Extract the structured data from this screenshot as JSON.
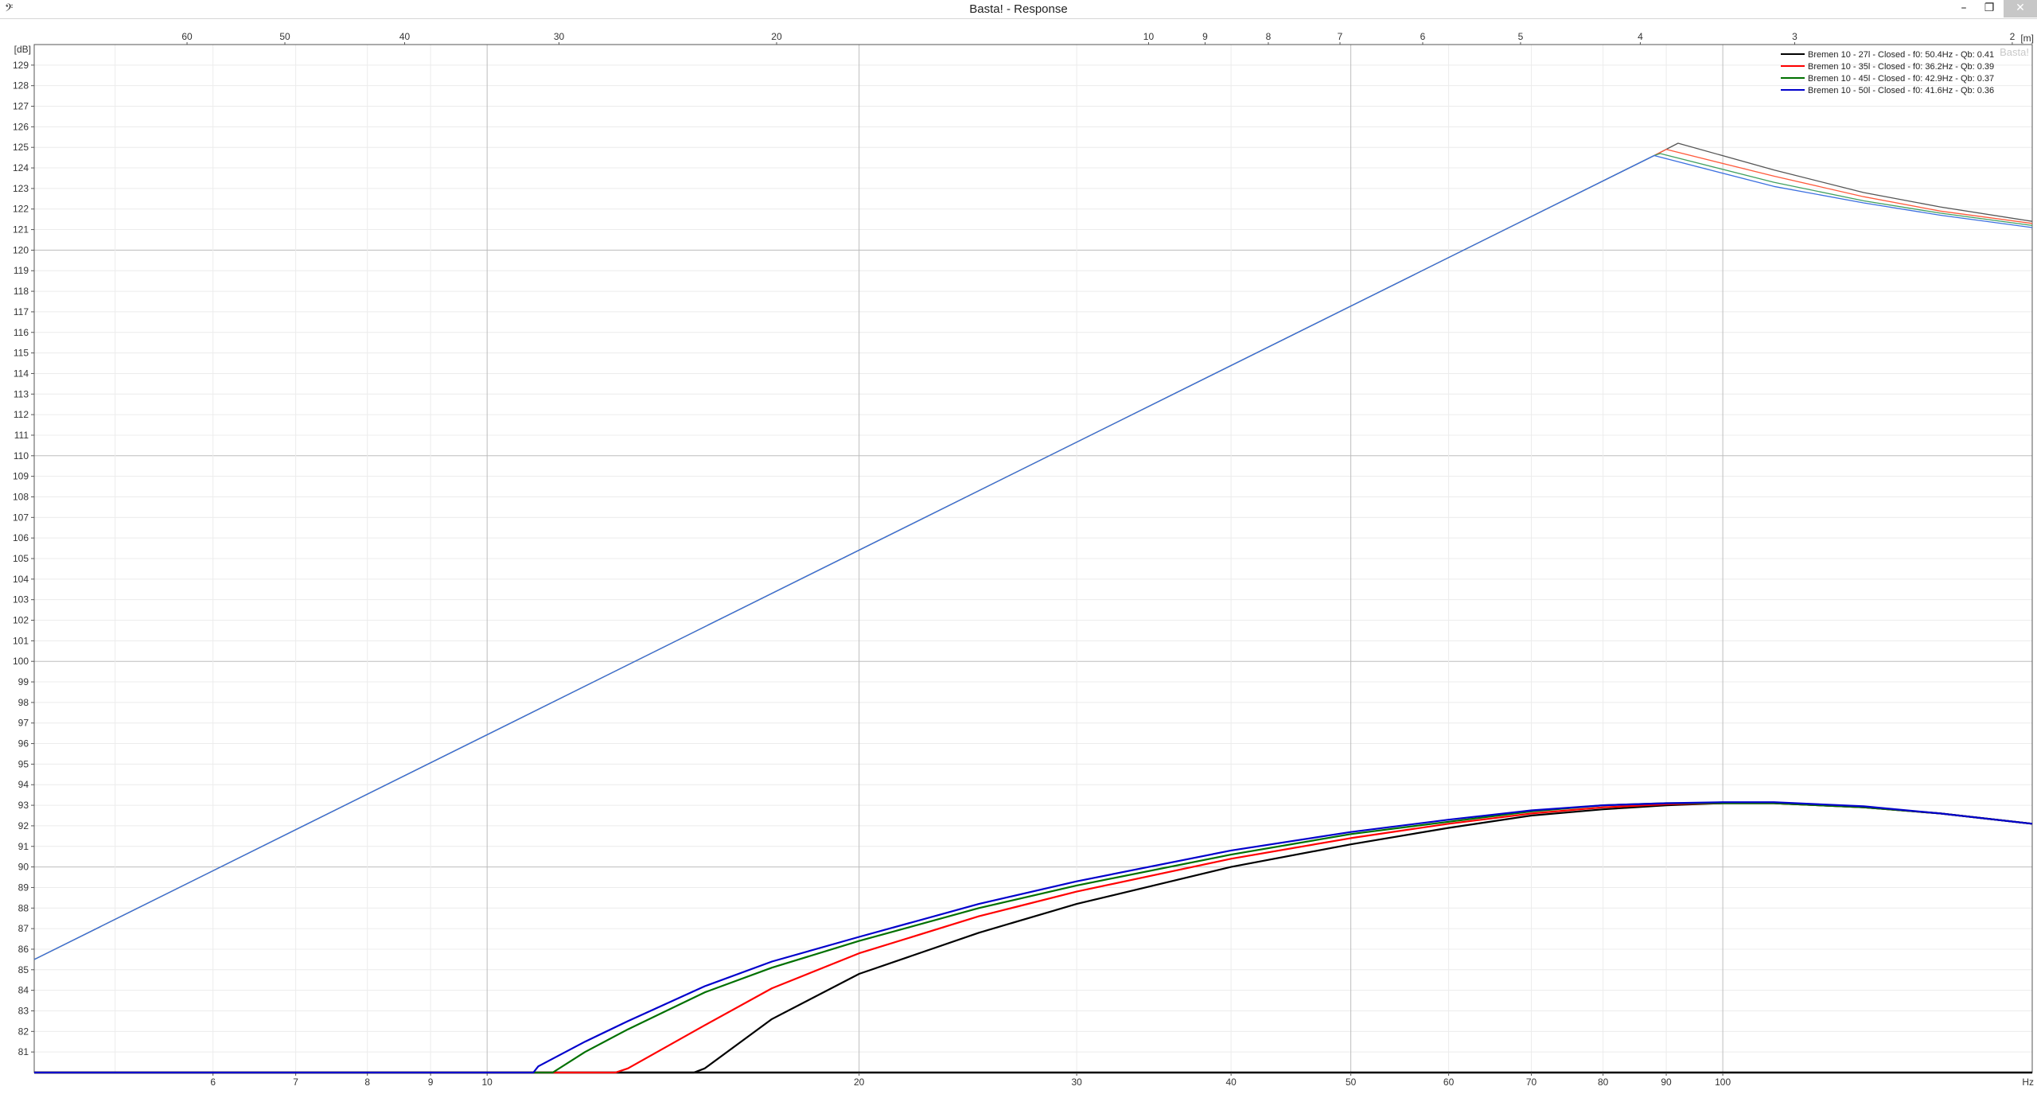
{
  "window": {
    "title": "Basta! - Response",
    "icon": "bass-clef-icon",
    "minimize": "–",
    "restore": "❐",
    "close": "✕"
  },
  "chart_data": {
    "type": "line",
    "title": "",
    "watermark": "Basta!",
    "xlabel": "",
    "x_unit": "Hz",
    "y_unit": "[dB]",
    "top_unit": "[m]",
    "x_scale": "log",
    "xlim": [
      4.3,
      178
    ],
    "ylim": [
      80,
      130
    ],
    "grid": true,
    "legend_position": "top-right",
    "x_ticks": [
      6,
      7,
      8,
      9,
      10,
      20,
      30,
      40,
      50,
      60,
      70,
      80,
      90,
      100
    ],
    "x_major_grid": [
      10,
      20,
      50,
      100
    ],
    "top_ticks": [
      60,
      50,
      40,
      30,
      20,
      10,
      9,
      8,
      7,
      6,
      5,
      4,
      3,
      2
    ],
    "y_ticks": [
      81,
      82,
      83,
      84,
      85,
      86,
      87,
      88,
      89,
      90,
      91,
      92,
      93,
      94,
      95,
      96,
      97,
      98,
      99,
      100,
      101,
      102,
      103,
      104,
      105,
      106,
      107,
      108,
      109,
      110,
      111,
      112,
      113,
      114,
      115,
      116,
      117,
      118,
      119,
      120,
      121,
      122,
      123,
      124,
      125,
      126,
      127,
      128,
      129
    ],
    "y_major_grid": [
      90,
      100,
      110,
      120
    ],
    "room_gain_series": [
      {
        "name": "",
        "color": "#555555",
        "x": [
          4.3,
          88,
          92,
          110,
          130,
          150,
          178
        ],
        "y": [
          85.5,
          124.6,
          125.2,
          123.9,
          122.8,
          122.1,
          121.4
        ]
      },
      {
        "name": "",
        "color": "#ff5a3c",
        "x": [
          4.3,
          88,
          90,
          110,
          130,
          150,
          178
        ],
        "y": [
          85.5,
          124.6,
          124.9,
          123.6,
          122.6,
          121.9,
          121.3
        ]
      },
      {
        "name": "",
        "color": "#40a060",
        "x": [
          4.3,
          88,
          89,
          110,
          130,
          150,
          178
        ],
        "y": [
          85.5,
          124.6,
          124.7,
          123.3,
          122.4,
          121.8,
          121.2
        ]
      },
      {
        "name": "",
        "color": "#3b6fe0",
        "x": [
          4.3,
          88,
          110,
          130,
          150,
          178
        ],
        "y": [
          85.5,
          124.6,
          123.1,
          122.3,
          121.7,
          121.1
        ]
      }
    ],
    "series": [
      {
        "name": "Bremen 10 - 27l - Closed - f0: 50.4Hz - Qb: 0.41",
        "color": "#000000",
        "x": [
          4.3,
          14.7,
          15,
          17,
          20,
          25,
          30,
          40,
          50,
          60,
          70,
          80,
          90,
          100,
          110,
          130,
          150,
          178
        ],
        "y": [
          80,
          80,
          80.2,
          82.6,
          84.8,
          86.8,
          88.2,
          90.0,
          91.1,
          91.9,
          92.5,
          92.8,
          93.0,
          93.1,
          93.1,
          92.9,
          92.6,
          92.1
        ]
      },
      {
        "name": "Bremen 10 - 35l - Closed - f0: 36.2Hz - Qb: 0.39",
        "color": "#ff0000",
        "x": [
          4.3,
          12.7,
          13,
          15,
          17,
          20,
          25,
          30,
          40,
          50,
          60,
          70,
          80,
          90,
          100,
          110,
          130,
          150,
          178
        ],
        "y": [
          80,
          80,
          80.2,
          82.3,
          84.1,
          85.8,
          87.6,
          88.8,
          90.4,
          91.4,
          92.1,
          92.6,
          92.9,
          93.05,
          93.1,
          93.1,
          92.9,
          92.6,
          92.1
        ]
      },
      {
        "name": "Bremen 10 - 45l - Closed - f0: 42.9Hz - Qb: 0.37",
        "color": "#007000",
        "x": [
          4.3,
          11.3,
          12,
          13,
          15,
          17,
          20,
          25,
          30,
          40,
          50,
          60,
          70,
          80,
          90,
          100,
          110,
          130,
          150,
          178
        ],
        "y": [
          80,
          80,
          81.0,
          82.1,
          83.9,
          85.1,
          86.4,
          88.0,
          89.1,
          90.6,
          91.6,
          92.2,
          92.7,
          93.0,
          93.1,
          93.1,
          93.1,
          92.9,
          92.6,
          92.1
        ]
      },
      {
        "name": "Bremen 10 - 50l - Closed - f0: 41.6Hz - Qb: 0.36",
        "color": "#0000cc",
        "x": [
          4.3,
          10.9,
          11,
          12,
          13,
          15,
          17,
          20,
          25,
          30,
          40,
          50,
          60,
          70,
          80,
          90,
          100,
          110,
          130,
          150,
          178
        ],
        "y": [
          80,
          80,
          80.3,
          81.5,
          82.5,
          84.2,
          85.4,
          86.6,
          88.2,
          89.3,
          90.8,
          91.7,
          92.3,
          92.75,
          93.0,
          93.1,
          93.15,
          93.15,
          92.95,
          92.6,
          92.1
        ]
      }
    ]
  }
}
